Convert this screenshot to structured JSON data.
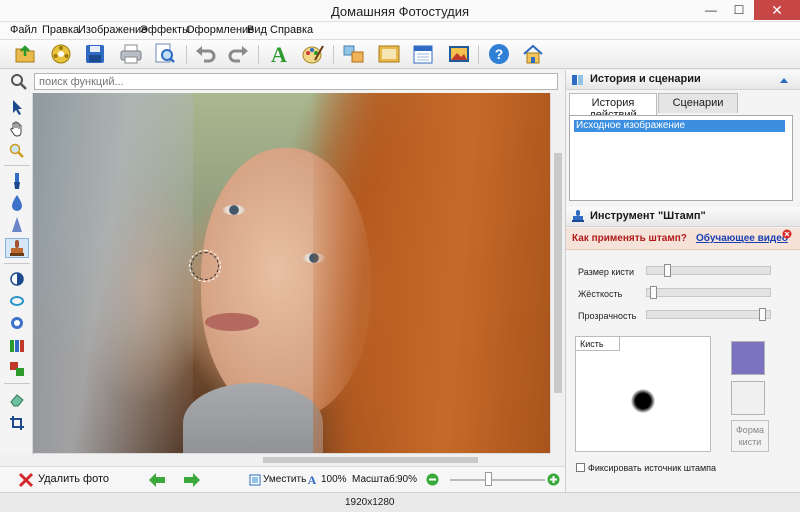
{
  "window": {
    "title": "Домашняя Фотостудия",
    "minimize": "—",
    "maximize": "☐",
    "close": "✕"
  },
  "menu": [
    "Файл",
    "Правка",
    "Изображение",
    "Эффекты",
    "Оформление",
    "Вид",
    "Справка"
  ],
  "toolbar": {
    "icons": [
      "open-icon",
      "save-icon",
      "print-icon",
      "undo-icon",
      "redo-icon",
      "text-icon",
      "palette-icon",
      "help-icon",
      "home-icon"
    ]
  },
  "search": {
    "placeholder": "поиск функций..."
  },
  "left_tools": {
    "icons": [
      "pointer-icon",
      "hand-icon",
      "magnifier-icon",
      "brush-icon",
      "drop-icon",
      "clone-icon",
      "stamp-icon",
      "contrast-icon",
      "color-icon",
      "levels-icon",
      "channels-icon",
      "eraser-icon",
      "crop-icon"
    ],
    "active": "stamp-icon"
  },
  "bottom": {
    "delete_label": "Удалить фото",
    "fit_label": "Уместить",
    "actual_label": "100%",
    "scale_label": "Масштаб:",
    "scale_value": "90%",
    "zoom_fraction": 0.4
  },
  "status": {
    "dimensions": "1920x1280"
  },
  "history_panel": {
    "title": "История и сценарии",
    "tabs": [
      "История действий",
      "Сценарии"
    ],
    "active_tab": "История действий",
    "items": [
      "Исходное изображение"
    ]
  },
  "stamp_panel": {
    "title": "Инструмент \"Штамп\"",
    "hint_question": "Как применять штамп?",
    "hint_link": "Обучающее видео",
    "params": [
      {
        "label": "Размер кисти",
        "value": 0.15
      },
      {
        "label": "Жёсткость",
        "value": 0.03
      },
      {
        "label": "Прозрачность",
        "value": 0.97
      }
    ],
    "brush_tab": "Кисть",
    "colors": {
      "primary": "#7b73c0",
      "secondary": "#f0f0f0"
    },
    "shape_button": "Форма кисти",
    "fix_source_label": "Фиксировать источник штампа",
    "fix_source_checked": false
  }
}
